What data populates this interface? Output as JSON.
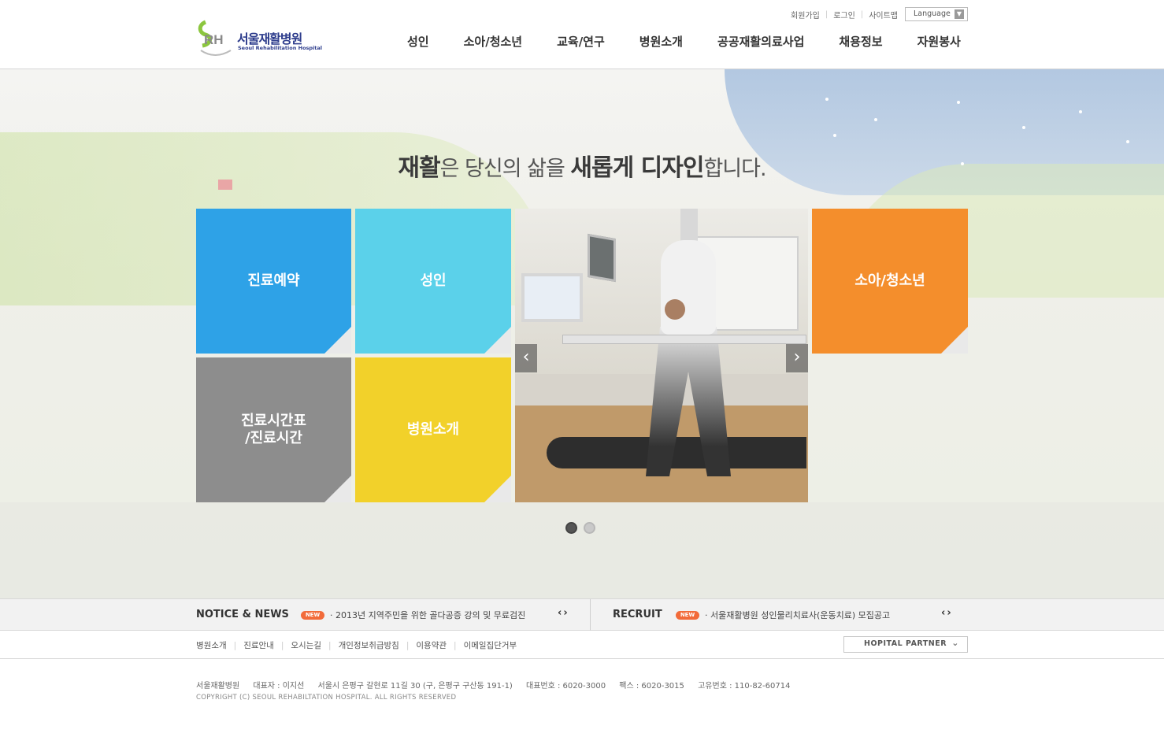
{
  "header": {
    "logo_text_ko": "서울재활병원",
    "logo_text_en": "Seoul Rehabilitation Hospital",
    "logo_mark": "SRH",
    "util_links": [
      "회원가입",
      "로그인",
      "사이트맵"
    ],
    "language_label": "Language"
  },
  "gnb": [
    "성인",
    "소아/청소년",
    "교육/연구",
    "병원소개",
    "공공재활의료사업",
    "채용정보",
    "자원봉사"
  ],
  "visual": {
    "slogan": {
      "p1": "재활",
      "p2": "은 당신의 삶을 ",
      "p3": "새롭게 디자인",
      "p4": "합니다."
    },
    "tiles": {
      "reservation": "진료예약",
      "adult": "성인",
      "schedule_1": "진료시간표",
      "schedule_2": "/진료시간",
      "about": "병원소개",
      "child": "소아/청소년"
    },
    "photo_prev": "‹",
    "photo_next": "›",
    "slide_count": 2,
    "active_slide": 1
  },
  "newsbar": {
    "notice_title": "NOTICE & NEWS",
    "notice_badge": "NEW",
    "notice_text": "· 2013년 지역주민을 위한 골다공증 강의 및 무료검진",
    "recruit_title": "RECRUIT",
    "recruit_badge": "NEW",
    "recruit_text": "· 서울재활병원 성인물리치료사(운동치료) 모집공고",
    "arrows": "‹›"
  },
  "footer": {
    "links": [
      "병원소개",
      "진료안내",
      "오시는길",
      "개인정보취급방침",
      "이용약관",
      "이메일집단거부"
    ],
    "partner_label": "HOPITAL PARTNER",
    "address": [
      "서울재활병원",
      "대표자 : 이지선",
      "서울시 은평구 갈현로 11길 30 (구, 은평구 구산동 191-1)",
      "대표번호 : 6020-3000",
      "팩스 : 6020-3015",
      "고유번호 : 110-82-60714"
    ],
    "copyright": "COPYRIGHT (C) SEOUL REHABILTATION HOSPITAL. ALL RIGHTS RESERVED"
  },
  "colors": {
    "tile_blue": "#2ea2e7",
    "tile_sky": "#5bd1ea",
    "tile_gray": "#8d8d8d",
    "tile_yellow": "#f2d12a",
    "tile_orange": "#f48e2c",
    "new_badge": "#f26b3a",
    "brand_navy": "#2d3c8c"
  }
}
